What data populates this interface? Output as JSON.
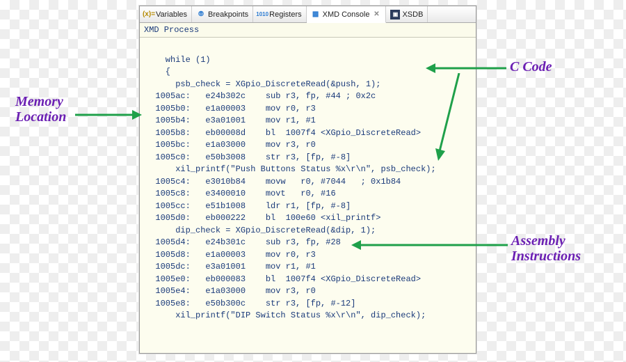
{
  "tabs": {
    "variables": "Variables",
    "breakpoints": "Breakpoints",
    "registers": "Registers",
    "xmd": "XMD Console",
    "xsdb": "XSDB"
  },
  "subtitle": "XMD Process",
  "code_lines": [
    "",
    "    while (1)",
    "    {",
    "      psb_check = XGpio_DiscreteRead(&push, 1);",
    "  1005ac:   e24b302c    sub r3, fp, #44 ; 0x2c",
    "  1005b0:   e1a00003    mov r0, r3",
    "  1005b4:   e3a01001    mov r1, #1",
    "  1005b8:   eb00008d    bl  1007f4 <XGpio_DiscreteRead>",
    "  1005bc:   e1a03000    mov r3, r0",
    "  1005c0:   e50b3008    str r3, [fp, #-8]",
    "      xil_printf(\"Push Buttons Status %x\\r\\n\", psb_check);",
    "  1005c4:   e3010b84    movw   r0, #7044   ; 0x1b84",
    "  1005c8:   e3400010    movt   r0, #16",
    "  1005cc:   e51b1008    ldr r1, [fp, #-8]",
    "  1005d0:   eb000222    bl  100e60 <xil_printf>",
    "      dip_check = XGpio_DiscreteRead(&dip, 1);",
    "  1005d4:   e24b301c    sub r3, fp, #28",
    "  1005d8:   e1a00003    mov r0, r3",
    "  1005dc:   e3a01001    mov r1, #1",
    "  1005e0:   eb000083    bl  1007f4 <XGpio_DiscreteRead>",
    "  1005e4:   e1a03000    mov r3, r0",
    "  1005e8:   e50b300c    str r3, [fp, #-12]",
    "      xil_printf(\"DIP Switch Status %x\\r\\n\", dip_check);"
  ],
  "callouts": {
    "memory": "Memory\nLocation",
    "ccode": "C Code",
    "asm": "Assembly\nInstructions"
  }
}
